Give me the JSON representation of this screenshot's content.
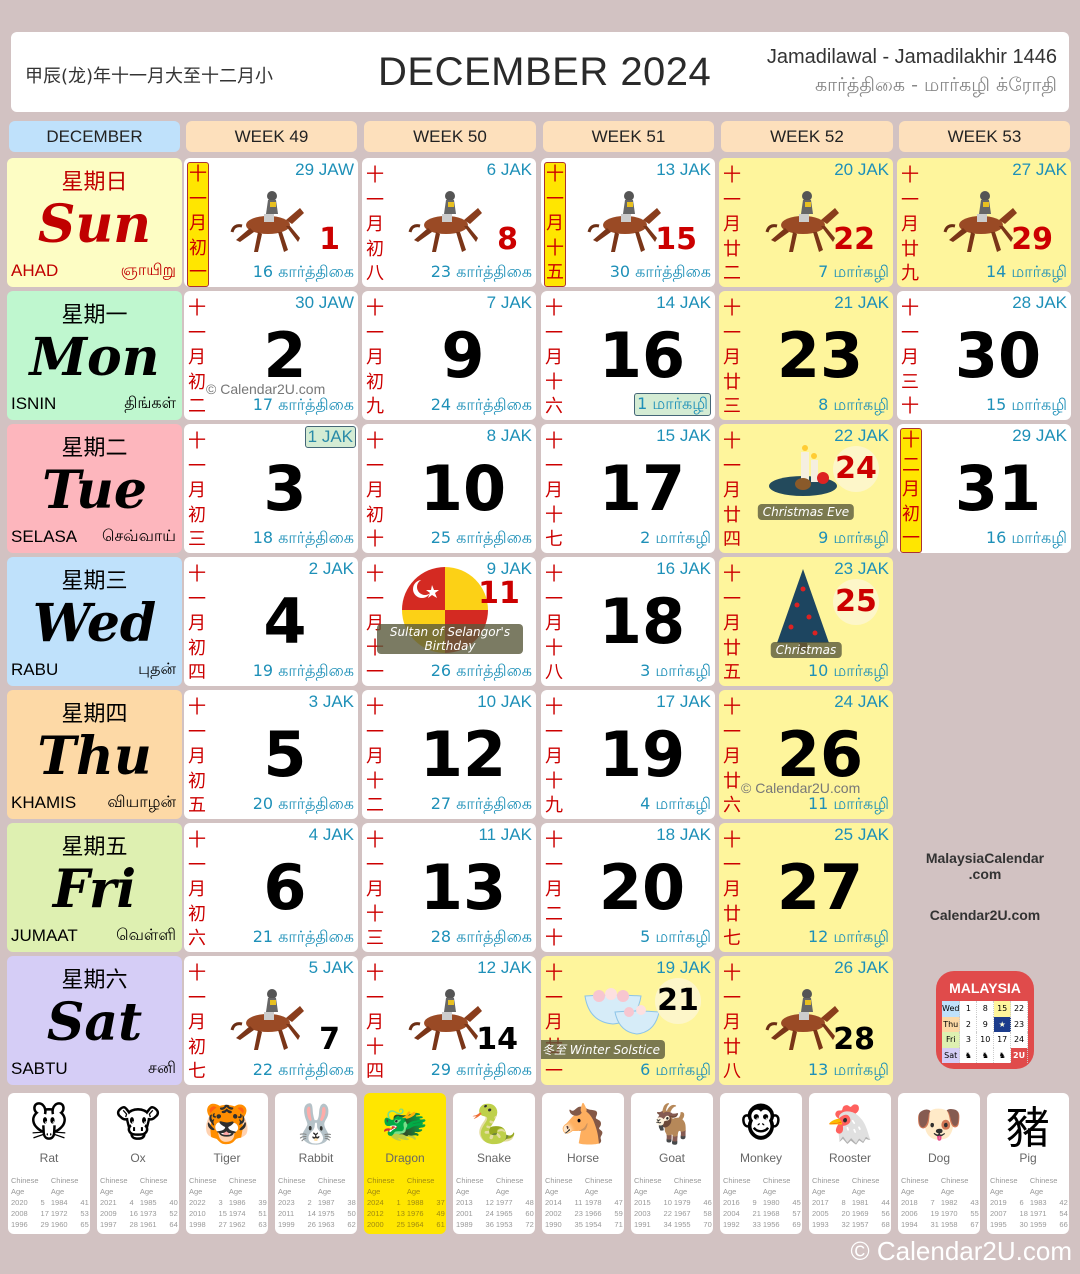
{
  "header": {
    "lunar_year": "甲辰(龙)年十一月大至十二月小",
    "title": "DECEMBER 2024",
    "islamic_months": "Jamadilawal - Jamadilakhir 1446",
    "tamil_months": "கார்த்திகை - மார்கழி  க்ரோதி"
  },
  "columns": [
    "DECEMBER",
    "WEEK 49",
    "WEEK 50",
    "WEEK 51",
    "WEEK 52",
    "WEEK 53"
  ],
  "colors": {
    "background": "#d2c2c2",
    "week_header": "#fde0bc",
    "month_header": "#bfe1fb",
    "holiday_cell": "#fef59c",
    "lunar_red": "#cc0000",
    "hijri_blue": "#1e90b8"
  },
  "days": [
    {
      "zh": "星期日",
      "en": "Sun",
      "ms": "AHAD",
      "ta": "ஞாயிறு",
      "bg": "#fdfdc4",
      "color": "#c00000"
    },
    {
      "zh": "星期一",
      "en": "Mon",
      "ms": "ISNIN",
      "ta": "திங்கள்",
      "bg": "#bff7cf",
      "color": "#000000"
    },
    {
      "zh": "星期二",
      "en": "Tue",
      "ms": "SELASA",
      "ta": "செவ்வாய்",
      "bg": "#fdb6bd",
      "color": "#000000"
    },
    {
      "zh": "星期三",
      "en": "Wed",
      "ms": "RABU",
      "ta": "புதன்",
      "bg": "#bfe1fb",
      "color": "#000000"
    },
    {
      "zh": "星期四",
      "en": "Thu",
      "ms": "KHAMIS",
      "ta": "வியாழன்",
      "bg": "#fdd9a6",
      "color": "#000000"
    },
    {
      "zh": "星期五",
      "en": "Fri",
      "ms": "JUMAAT",
      "ta": "வெள்ளி",
      "bg": "#def0b1",
      "color": "#000000"
    },
    {
      "zh": "星期六",
      "en": "Sat",
      "ms": "SABTU",
      "ta": "சனி",
      "bg": "#d5cdf6",
      "color": "#000000"
    }
  ],
  "cells": [
    {
      "col": 0,
      "row": 0,
      "date": "1",
      "lunar": "十一月初一",
      "lunar_first": true,
      "hijri": "29 JAW",
      "tamil": "16 கார்த்திகை",
      "style": "race-red",
      "hol": false
    },
    {
      "col": 1,
      "row": 0,
      "date": "8",
      "lunar": "十一月初八",
      "hijri": "6 JAK",
      "tamil": "23 கார்த்திகை",
      "style": "race-red",
      "hol": false
    },
    {
      "col": 2,
      "row": 0,
      "date": "15",
      "lunar": "十一月十五",
      "lunar_first": true,
      "hijri": "13 JAK",
      "tamil": "30 கார்த்திகை",
      "style": "race-red",
      "hol": false
    },
    {
      "col": 3,
      "row": 0,
      "date": "22",
      "lunar": "十一月廿二",
      "hijri": "20 JAK",
      "tamil": "7 மார்கழி",
      "style": "race-red",
      "hol": true
    },
    {
      "col": 4,
      "row": 0,
      "date": "29",
      "lunar": "十一月廿九",
      "hijri": "27 JAK",
      "tamil": "14 மார்கழி",
      "style": "race-red",
      "hol": true
    },
    {
      "col": 0,
      "row": 1,
      "date": "2",
      "lunar": "十一月初二",
      "hijri": "30 JAW",
      "tamil": "17 கார்த்திகை",
      "style": "big",
      "hol": false,
      "watermark": "© Calendar2U.com"
    },
    {
      "col": 1,
      "row": 1,
      "date": "9",
      "lunar": "十一月初九",
      "hijri": "7 JAK",
      "tamil": "24 கார்த்திகை",
      "style": "big",
      "hol": false
    },
    {
      "col": 2,
      "row": 1,
      "date": "16",
      "lunar": "十一月十六",
      "hijri": "14 JAK",
      "tamil": "1 மார்கழி",
      "tamil_first": true,
      "style": "big",
      "hol": false
    },
    {
      "col": 3,
      "row": 1,
      "date": "23",
      "lunar": "十一月廿三",
      "hijri": "21 JAK",
      "tamil": "8 மார்கழி",
      "style": "big",
      "hol": true
    },
    {
      "col": 4,
      "row": 1,
      "date": "30",
      "lunar": "十一月三十",
      "hijri": "28 JAK",
      "tamil": "15 மார்கழி",
      "style": "big",
      "hol": false
    },
    {
      "col": 0,
      "row": 2,
      "date": "3",
      "lunar": "十一月初三",
      "hijri": "1 JAK",
      "hijri_first": true,
      "tamil": "18 கார்த்திகை",
      "style": "big",
      "hol": false
    },
    {
      "col": 1,
      "row": 2,
      "date": "10",
      "lunar": "十一月初十",
      "hijri": "8 JAK",
      "tamil": "25 கார்த்திகை",
      "style": "big",
      "hol": false
    },
    {
      "col": 2,
      "row": 2,
      "date": "17",
      "lunar": "十一月十七",
      "hijri": "15 JAK",
      "tamil": "2 மார்கழி",
      "style": "big",
      "hol": false
    },
    {
      "col": 3,
      "row": 2,
      "date": "24",
      "lunar": "十一月廿四",
      "hijri": "22 JAK",
      "tamil": "9 மார்கழி",
      "style": "event",
      "hol": true,
      "event": "Christmas Eve",
      "icon": "candles"
    },
    {
      "col": 4,
      "row": 2,
      "date": "31",
      "lunar": "十二月初一",
      "lunar_first": true,
      "hijri": "29 JAK",
      "tamil": "16 மார்கழி",
      "style": "big",
      "hol": false
    },
    {
      "col": 0,
      "row": 3,
      "date": "4",
      "lunar": "十一月初四",
      "hijri": "2 JAK",
      "tamil": "19 கார்த்திகை",
      "style": "big",
      "hol": false
    },
    {
      "col": 1,
      "row": 3,
      "date": "11",
      "lunar": "十一月十一",
      "hijri": "9 JAK",
      "tamil": "26 கார்த்திகை",
      "style": "event",
      "hol": false,
      "event": "Sultan of Selangor's Birthday",
      "icon": "selangor-flag"
    },
    {
      "col": 2,
      "row": 3,
      "date": "18",
      "lunar": "十一月十八",
      "hijri": "16 JAK",
      "tamil": "3 மார்கழி",
      "style": "big",
      "hol": false
    },
    {
      "col": 3,
      "row": 3,
      "date": "25",
      "lunar": "十一月廿五",
      "hijri": "23 JAK",
      "tamil": "10 மார்கழி",
      "style": "event",
      "hol": true,
      "event": "Christmas",
      "icon": "tree"
    },
    {
      "col": 0,
      "row": 4,
      "date": "5",
      "lunar": "十一月初五",
      "hijri": "3 JAK",
      "tamil": "20 கார்த்திகை",
      "style": "big",
      "hol": false
    },
    {
      "col": 1,
      "row": 4,
      "date": "12",
      "lunar": "十一月十二",
      "hijri": "10 JAK",
      "tamil": "27 கார்த்திகை",
      "style": "big",
      "hol": false
    },
    {
      "col": 2,
      "row": 4,
      "date": "19",
      "lunar": "十一月十九",
      "hijri": "17 JAK",
      "tamil": "4 மார்கழி",
      "style": "big",
      "hol": false
    },
    {
      "col": 3,
      "row": 4,
      "date": "26",
      "lunar": "十一月廿六",
      "hijri": "24 JAK",
      "tamil": "11 மார்கழி",
      "style": "big",
      "hol": true,
      "watermark": "© Calendar2U.com"
    },
    {
      "col": 0,
      "row": 5,
      "date": "6",
      "lunar": "十一月初六",
      "hijri": "4 JAK",
      "tamil": "21 கார்த்திகை",
      "style": "big",
      "hol": false
    },
    {
      "col": 1,
      "row": 5,
      "date": "13",
      "lunar": "十一月十三",
      "hijri": "11 JAK",
      "tamil": "28 கார்த்திகை",
      "style": "big",
      "hol": false
    },
    {
      "col": 2,
      "row": 5,
      "date": "20",
      "lunar": "十一月二十",
      "hijri": "18 JAK",
      "tamil": "5 மார்கழி",
      "style": "big",
      "hol": false
    },
    {
      "col": 3,
      "row": 5,
      "date": "27",
      "lunar": "十一月廿七",
      "hijri": "25 JAK",
      "tamil": "12 மார்கழி",
      "style": "big",
      "hol": true
    },
    {
      "col": 0,
      "row": 6,
      "date": "7",
      "lunar": "十一月初七",
      "hijri": "5 JAK",
      "tamil": "22 கார்த்திகை",
      "style": "race",
      "hol": false
    },
    {
      "col": 1,
      "row": 6,
      "date": "14",
      "lunar": "十一月十四",
      "hijri": "12 JAK",
      "tamil": "29 கார்த்திகை",
      "style": "race",
      "hol": false
    },
    {
      "col": 2,
      "row": 6,
      "date": "21",
      "lunar": "十一月廿一",
      "hijri": "19 JAK",
      "tamil": "6 மார்கழி",
      "style": "event-black",
      "hol": true,
      "event": "冬至 Winter Solstice",
      "icon": "bowls"
    },
    {
      "col": 3,
      "row": 6,
      "date": "28",
      "lunar": "十一月廿八",
      "hijri": "26 JAK",
      "tamil": "13 மார்கழி",
      "style": "race",
      "hol": true
    }
  ],
  "side": {
    "site1_line1": "MalaysiaCalendar",
    "site1_line2": ".com",
    "site2": "Calendar2U.com",
    "app_icon_title": "MALAYSIA",
    "app_icon_badge": "2U"
  },
  "zodiac_header": [
    "Chinese",
    "Age",
    "Chinese",
    "Age"
  ],
  "zodiac": [
    {
      "name": "Rat",
      "icon": "🐭",
      "rows": [
        [
          "2020",
          "5",
          "1984",
          "41"
        ],
        [
          "2008",
          "17",
          "1972",
          "53"
        ],
        [
          "1996",
          "29",
          "1960",
          "65"
        ]
      ]
    },
    {
      "name": "Ox",
      "icon": "🐮",
      "rows": [
        [
          "2021",
          "4",
          "1985",
          "40"
        ],
        [
          "2009",
          "16",
          "1973",
          "52"
        ],
        [
          "1997",
          "28",
          "1961",
          "64"
        ]
      ]
    },
    {
      "name": "Tiger",
      "icon": "🐯",
      "rows": [
        [
          "2022",
          "3",
          "1986",
          "39"
        ],
        [
          "2010",
          "15",
          "1974",
          "51"
        ],
        [
          "1998",
          "27",
          "1962",
          "63"
        ]
      ]
    },
    {
      "name": "Rabbit",
      "icon": "🐰",
      "rows": [
        [
          "2023",
          "2",
          "1987",
          "38"
        ],
        [
          "2011",
          "14",
          "1975",
          "50"
        ],
        [
          "1999",
          "26",
          "1963",
          "62"
        ]
      ]
    },
    {
      "name": "Dragon",
      "icon": "🐲",
      "active": true,
      "rows": [
        [
          "2024",
          "1",
          "1988",
          "37"
        ],
        [
          "2012",
          "13",
          "1976",
          "49"
        ],
        [
          "2000",
          "25",
          "1964",
          "61"
        ]
      ]
    },
    {
      "name": "Snake",
      "icon": "🐍",
      "rows": [
        [
          "2013",
          "12",
          "1977",
          "48"
        ],
        [
          "2001",
          "24",
          "1965",
          "60"
        ],
        [
          "1989",
          "36",
          "1953",
          "72"
        ]
      ]
    },
    {
      "name": "Horse",
      "icon": "🐴",
      "rows": [
        [
          "2014",
          "11",
          "1978",
          "47"
        ],
        [
          "2002",
          "23",
          "1966",
          "59"
        ],
        [
          "1990",
          "35",
          "1954",
          "71"
        ]
      ]
    },
    {
      "name": "Goat",
      "icon": "🐐",
      "rows": [
        [
          "2015",
          "10",
          "1979",
          "46"
        ],
        [
          "2003",
          "22",
          "1967",
          "58"
        ],
        [
          "1991",
          "34",
          "1955",
          "70"
        ]
      ]
    },
    {
      "name": "Monkey",
      "icon": "🐵",
      "rows": [
        [
          "2016",
          "9",
          "1980",
          "45"
        ],
        [
          "2004",
          "21",
          "1968",
          "57"
        ],
        [
          "1992",
          "33",
          "1956",
          "69"
        ]
      ]
    },
    {
      "name": "Rooster",
      "icon": "🐔",
      "rows": [
        [
          "2017",
          "8",
          "1981",
          "44"
        ],
        [
          "2005",
          "20",
          "1969",
          "56"
        ],
        [
          "1993",
          "32",
          "1957",
          "68"
        ]
      ]
    },
    {
      "name": "Dog",
      "icon": "🐶",
      "rows": [
        [
          "2018",
          "7",
          "1982",
          "43"
        ],
        [
          "2006",
          "19",
          "1970",
          "55"
        ],
        [
          "1994",
          "31",
          "1958",
          "67"
        ]
      ]
    },
    {
      "name": "Pig",
      "icon": "豬",
      "rows": [
        [
          "2019",
          "6",
          "1983",
          "42"
        ],
        [
          "2007",
          "18",
          "1971",
          "54"
        ],
        [
          "1995",
          "30",
          "1959",
          "66"
        ]
      ]
    }
  ],
  "footer": "© Calendar2U.com"
}
